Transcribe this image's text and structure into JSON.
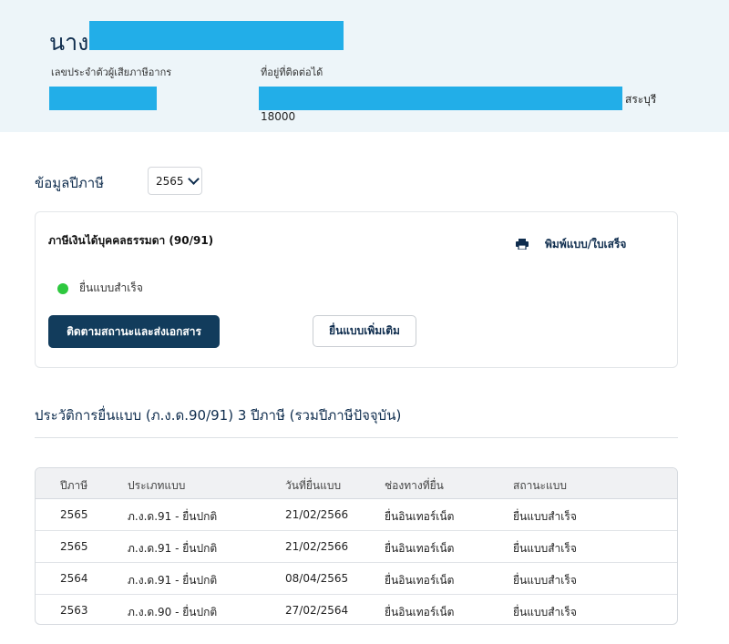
{
  "header": {
    "title_prefix": "นาง",
    "tax_id_label": "เลขประจำตัวผู้เสียภาษีอากร",
    "address_label": "ที่อยู่ที่ติดต่อได้",
    "province": "สระบุรี",
    "postcode": "18000",
    "redaction_color": "#22aee8"
  },
  "tax_year": {
    "label": "ข้อมูลปีภาษี",
    "selected": "2565"
  },
  "card": {
    "title": "ภาษีเงินได้บุคคลธรรมดา (90/91)",
    "print_label": "พิมพ์แบบ/ใบเสร็จ",
    "print_icon": "printer-icon",
    "status_text": "ยื่นแบบสำเร็จ",
    "status_color": "#2ec83f",
    "track_button": "ติดตามสถานะและส่งเอกสาร",
    "additional_button": "ยื่นแบบเพิ่มเติม"
  },
  "history": {
    "title": "ประวัติการยื่นแบบ (ภ.ง.ด.90/91) 3 ปีภาษี (รวมปีภาษีปัจจุบัน)",
    "columns": [
      "ปีภาษี",
      "ประเภทแบบ",
      "วันที่ยื่นแบบ",
      "ช่องทางที่ยื่น",
      "สถานะแบบ"
    ],
    "rows": [
      [
        "2565",
        "ภ.ง.ด.91 - ยื่นปกติ",
        "21/02/2566",
        "ยื่นอินเทอร์เน็ต",
        "ยื่นแบบสำเร็จ"
      ],
      [
        "2565",
        "ภ.ง.ด.91 - ยื่นปกติ",
        "21/02/2566",
        "ยื่นอินเทอร์เน็ต",
        "ยื่นแบบสำเร็จ"
      ],
      [
        "2564",
        "ภ.ง.ด.91 - ยื่นปกติ",
        "08/04/2565",
        "ยื่นอินเทอร์เน็ต",
        "ยื่นแบบสำเร็จ"
      ],
      [
        "2563",
        "ภ.ง.ด.90 - ยื่นปกติ",
        "27/02/2564",
        "ยื่นอินเทอร์เน็ต",
        "ยื่นแบบสำเร็จ"
      ]
    ]
  }
}
